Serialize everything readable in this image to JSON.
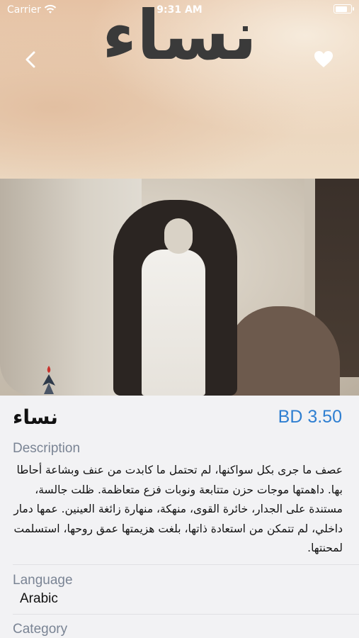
{
  "status_bar": {
    "carrier": "Carrier",
    "time": "9:31 AM",
    "battery_level": 0.8
  },
  "cover": {
    "title_art": "نساء"
  },
  "icons": {
    "back": "chevron-left-icon",
    "favorite": "heart-icon",
    "wifi": "wifi-icon",
    "battery": "battery-icon"
  },
  "product": {
    "title": "نساء",
    "price": "BD 3.50"
  },
  "sections": {
    "description_label": "Description",
    "description_text": "عصف ما جرى بكل سواكنها، لم تحتمل ما كابدت من عنف وبشاعة أحاطا بها. داهمتها موجات حزن متتابعة ونوبات فزع متعاظمة. ظلت جالسة، مستندة على الجدار، خائرة القوى، منهكة، منهارة زائغة العينين. عمها دمار داخلي، لم تتمكن من استعادة ذاتها، بلغت هزيمتها عمق روحها، استسلمت لمحنتها.",
    "language_label": "Language",
    "language_value": "Arabic",
    "category_label": "Category"
  },
  "colors": {
    "price": "#2f7fd1",
    "label": "#7a8494",
    "background": "#f2f2f4"
  }
}
